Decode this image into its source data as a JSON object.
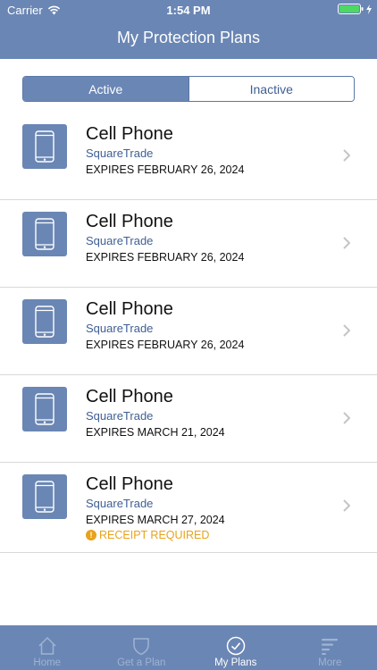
{
  "status_bar": {
    "carrier": "Carrier",
    "time": "1:54 PM"
  },
  "header": {
    "title": "My Protection Plans"
  },
  "segments": {
    "active_label": "Active",
    "inactive_label": "Inactive"
  },
  "plans": [
    {
      "name": "Cell Phone",
      "provider": "SquareTrade",
      "expiry": "EXPIRES FEBRUARY 26, 2024",
      "icon": "phone-icon"
    },
    {
      "name": "Cell Phone",
      "provider": "SquareTrade",
      "expiry": "EXPIRES FEBRUARY 26, 2024",
      "icon": "phone-icon"
    },
    {
      "name": "Cell Phone",
      "provider": "SquareTrade",
      "expiry": "EXPIRES FEBRUARY 26, 2024",
      "icon": "phone-icon"
    },
    {
      "name": "Cell Phone",
      "provider": "SquareTrade",
      "expiry": "EXPIRES MARCH 21, 2024",
      "icon": "phone-icon"
    },
    {
      "name": "Cell Phone",
      "provider": "SquareTrade",
      "expiry": "EXPIRES MARCH 27, 2024",
      "warning": "RECEIPT REQUIRED",
      "icon": "phone-icon"
    }
  ],
  "tabs": [
    {
      "label": "Home",
      "icon": "home-icon"
    },
    {
      "label": "Get a Plan",
      "icon": "shield-icon"
    },
    {
      "label": "My Plans",
      "icon": "check-circle-icon",
      "selected": true
    },
    {
      "label": "More",
      "icon": "menu-lines-icon"
    }
  ],
  "colors": {
    "brand": "#6a86b4",
    "provider_text": "#3f5f93",
    "warning": "#e8a21c",
    "battery": "#4cd964"
  }
}
